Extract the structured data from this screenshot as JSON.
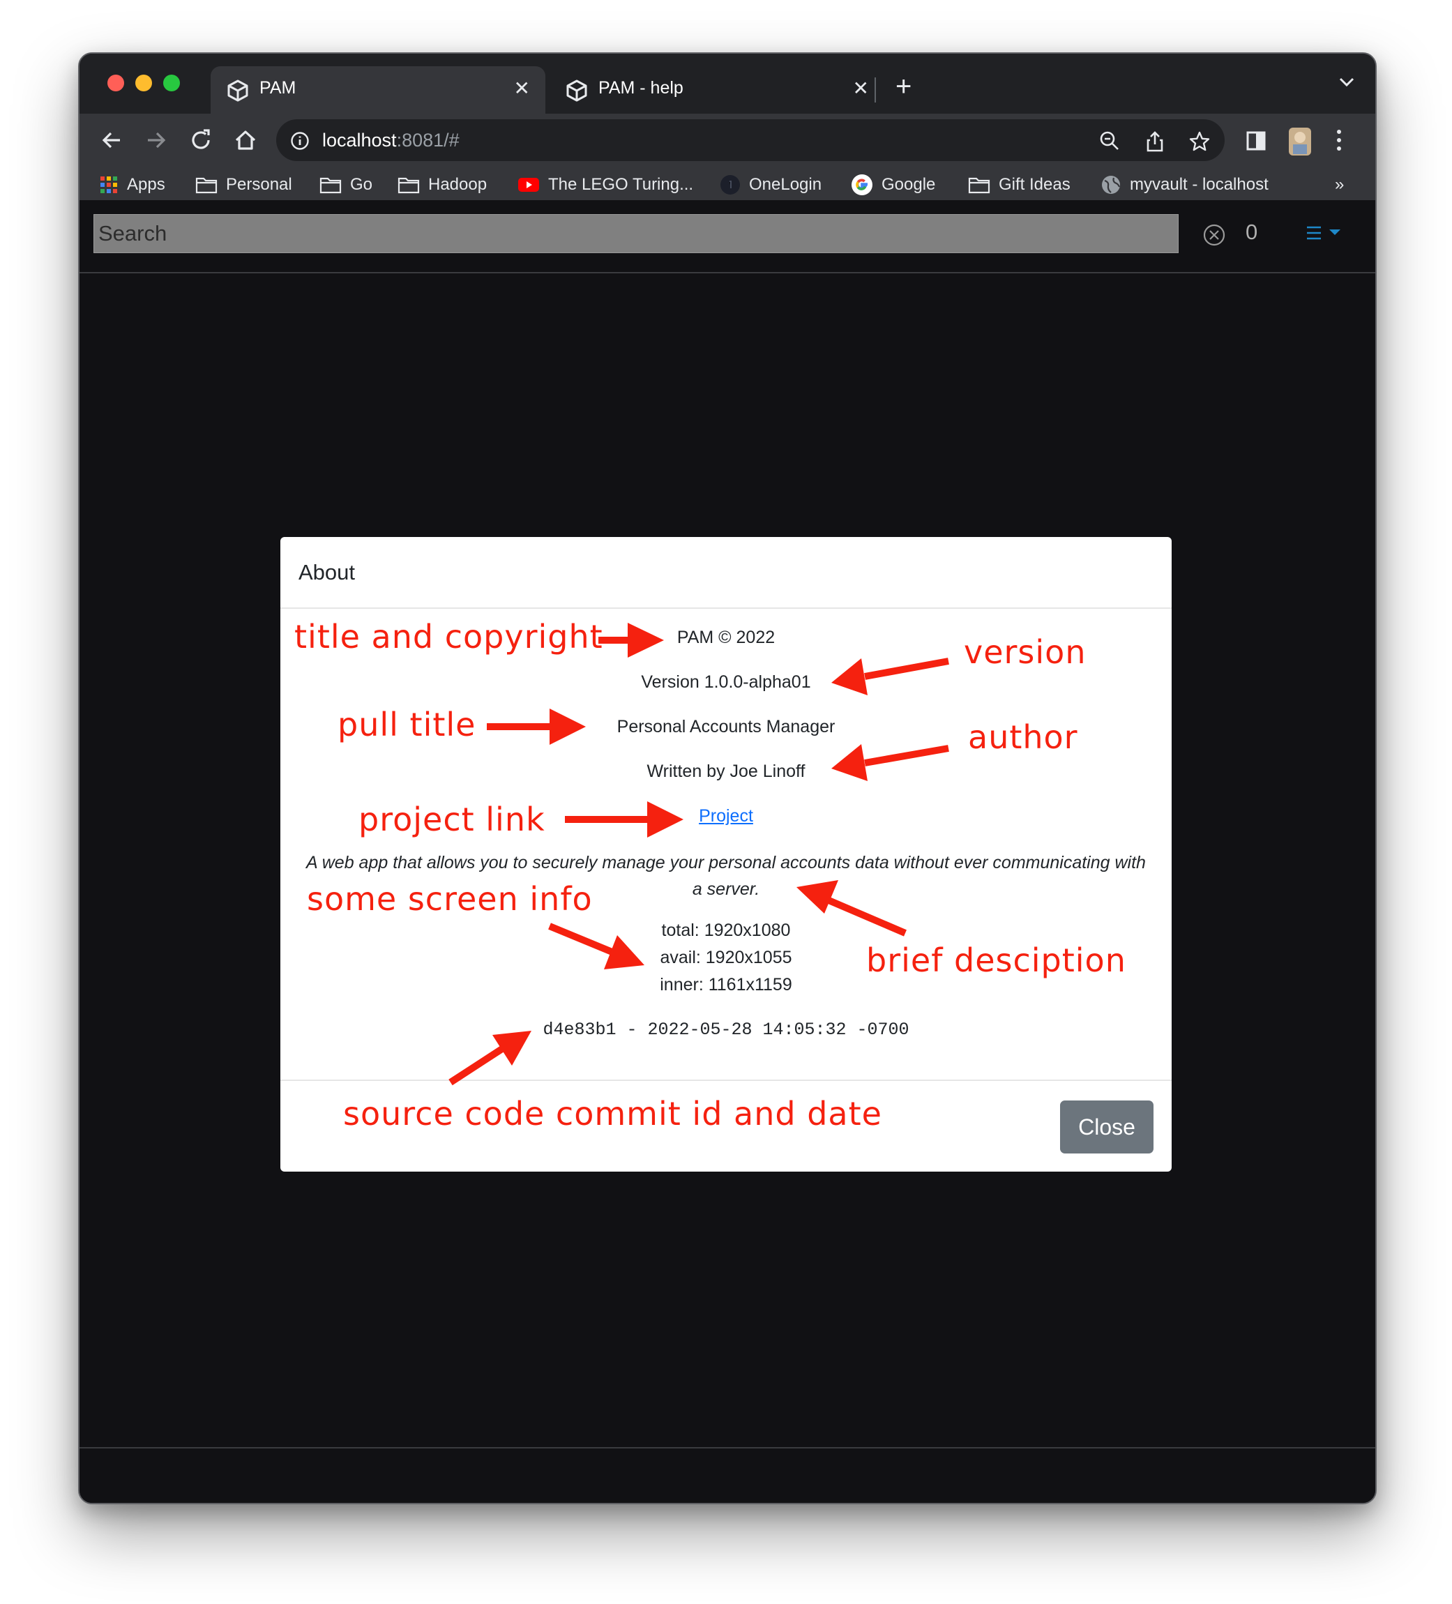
{
  "browser": {
    "tabs": [
      {
        "title": "PAM",
        "icon": "cube-icon",
        "active": true
      },
      {
        "title": "PAM - help",
        "icon": "cube-icon",
        "active": false
      }
    ],
    "url_host": "localhost",
    "url_rest": ":8081/#",
    "bookmarks": [
      {
        "label": "Apps",
        "icon": "apps-grid-icon"
      },
      {
        "label": "Personal",
        "icon": "folder-icon"
      },
      {
        "label": "Go",
        "icon": "folder-icon"
      },
      {
        "label": "Hadoop",
        "icon": "folder-icon"
      },
      {
        "label": "The LEGO Turing...",
        "icon": "youtube-icon"
      },
      {
        "label": "OneLogin",
        "icon": "onelogin-icon"
      },
      {
        "label": "Google",
        "icon": "google-icon"
      },
      {
        "label": "Gift Ideas",
        "icon": "folder-icon"
      },
      {
        "label": "myvault - localhost",
        "icon": "globe-icon"
      }
    ],
    "bookmarks_overflow": "»"
  },
  "app": {
    "search_placeholder": "Search",
    "record_count": "0",
    "accent_color": "#1e88c8"
  },
  "modal": {
    "title": "About",
    "copyright": "PAM © 2022",
    "version": "Version 1.0.0-alpha01",
    "full_title": "Personal Accounts Manager",
    "author": "Written by Joe Linoff",
    "project_link": "Project",
    "description": "A web app that allows you to securely manage your personal accounts data without ever communicating with a server.",
    "screen": {
      "total": "total: 1920x1080",
      "avail": "avail: 1920x1055",
      "inner": "inner: 1161x1159"
    },
    "commit": "d4e83b1 - 2022-05-28 14:05:32 -0700",
    "close_label": "Close"
  },
  "annotations": {
    "title_copyright": "title and copyright",
    "version": "version",
    "pull_title": "pull title",
    "author": "author",
    "project_link": "project link",
    "screen_info": "some screen info",
    "brief_description": "brief desciption",
    "commit": "source code commit id and date",
    "color": "#f5210f"
  }
}
